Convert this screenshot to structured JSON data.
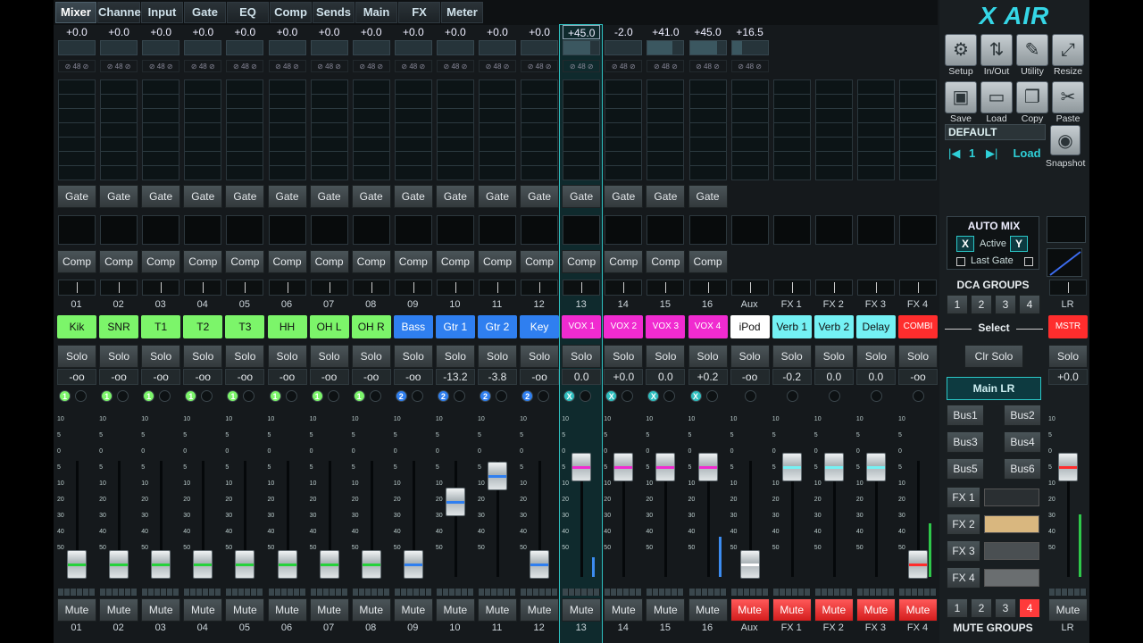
{
  "tabs": [
    "Mixer",
    "Channel",
    "Input",
    "Gate",
    "EQ",
    "Comp",
    "Sends",
    "Main",
    "FX",
    "Meter"
  ],
  "active_tab": "Mixer",
  "colors": {
    "green": "#7cf56a",
    "blue": "#2f7ff0",
    "magenta": "#f02bd0",
    "white": "#ffffff",
    "cyan": "#74f1f4",
    "red": "#ff2d2d",
    "teal": "#2fbfbf"
  },
  "channels": [
    {
      "num": "01",
      "name": "Kik",
      "color": "green",
      "gain": "+0.0",
      "fader_value": "-oo",
      "bus": "1",
      "bus_color": "green",
      "level": 0.0,
      "gate": "Gate",
      "comp": "Comp",
      "solo": "Solo",
      "mute": "Mute",
      "mute_on": false,
      "fline": "#26d23b",
      "meter": 0
    },
    {
      "num": "02",
      "name": "SNR",
      "color": "green",
      "gain": "+0.0",
      "fader_value": "-oo",
      "bus": "1",
      "bus_color": "green",
      "level": 0.0,
      "gate": "Gate",
      "comp": "Comp",
      "solo": "Solo",
      "mute": "Mute",
      "mute_on": false,
      "fline": "#26d23b",
      "meter": 0
    },
    {
      "num": "03",
      "name": "T1",
      "color": "green",
      "gain": "+0.0",
      "fader_value": "-oo",
      "bus": "1",
      "bus_color": "green",
      "level": 0.0,
      "gate": "Gate",
      "comp": "Comp",
      "solo": "Solo",
      "mute": "Mute",
      "mute_on": false,
      "fline": "#26d23b",
      "meter": 0
    },
    {
      "num": "04",
      "name": "T2",
      "color": "green",
      "gain": "+0.0",
      "fader_value": "-oo",
      "bus": "1",
      "bus_color": "green",
      "level": 0.0,
      "gate": "Gate",
      "comp": "Comp",
      "solo": "Solo",
      "mute": "Mute",
      "mute_on": false,
      "fline": "#26d23b",
      "meter": 0
    },
    {
      "num": "05",
      "name": "T3",
      "color": "green",
      "gain": "+0.0",
      "fader_value": "-oo",
      "bus": "1",
      "bus_color": "green",
      "level": 0.0,
      "gate": "Gate",
      "comp": "Comp",
      "solo": "Solo",
      "mute": "Mute",
      "mute_on": false,
      "fline": "#26d23b",
      "meter": 0
    },
    {
      "num": "06",
      "name": "HH",
      "color": "green",
      "gain": "+0.0",
      "fader_value": "-oo",
      "bus": "1",
      "bus_color": "green",
      "level": 0.0,
      "gate": "Gate",
      "comp": "Comp",
      "solo": "Solo",
      "mute": "Mute",
      "mute_on": false,
      "fline": "#26d23b",
      "meter": 0
    },
    {
      "num": "07",
      "name": "OH L",
      "color": "green",
      "gain": "+0.0",
      "fader_value": "-oo",
      "bus": "1",
      "bus_color": "green",
      "level": 0.0,
      "gate": "Gate",
      "comp": "Comp",
      "solo": "Solo",
      "mute": "Mute",
      "mute_on": false,
      "fline": "#26d23b",
      "meter": 0
    },
    {
      "num": "08",
      "name": "OH R",
      "color": "green",
      "gain": "+0.0",
      "fader_value": "-oo",
      "bus": "1",
      "bus_color": "green",
      "level": 0.0,
      "gate": "Gate",
      "comp": "Comp",
      "solo": "Solo",
      "mute": "Mute",
      "mute_on": false,
      "fline": "#26d23b",
      "meter": 0
    },
    {
      "num": "09",
      "name": "Bass",
      "color": "blue",
      "gain": "+0.0",
      "fader_value": "-oo",
      "bus": "2",
      "bus_color": "blue",
      "level": 0.0,
      "gate": "Gate",
      "comp": "Comp",
      "solo": "Solo",
      "mute": "Mute",
      "mute_on": false,
      "fline": "#2f7ff0",
      "meter": 0
    },
    {
      "num": "10",
      "name": "Gtr 1",
      "color": "blue",
      "gain": "+0.0",
      "fader_value": "-13.2",
      "bus": "2",
      "bus_color": "blue",
      "level": 0.48,
      "gate": "Gate",
      "comp": "Comp",
      "solo": "Solo",
      "mute": "Mute",
      "mute_on": false,
      "fline": "#2f7ff0",
      "meter": 0
    },
    {
      "num": "11",
      "name": "Gtr 2",
      "color": "blue",
      "gain": "+0.0",
      "fader_value": "-3.8",
      "bus": "2",
      "bus_color": "blue",
      "level": 0.68,
      "gate": "Gate",
      "comp": "Comp",
      "solo": "Solo",
      "mute": "Mute",
      "mute_on": false,
      "fline": "#2f7ff0",
      "meter": 0
    },
    {
      "num": "12",
      "name": "Key",
      "color": "blue",
      "gain": "+0.0",
      "fader_value": "-oo",
      "bus": "2",
      "bus_color": "blue",
      "level": 0.0,
      "gate": "Gate",
      "comp": "Comp",
      "solo": "Solo",
      "mute": "Mute",
      "mute_on": false,
      "fline": "#2f7ff0",
      "meter": 0
    },
    {
      "num": "13",
      "name": "VOX 1",
      "color": "magenta",
      "gain": "+45.0",
      "fader_value": "0.0",
      "bus": "X",
      "bus_color": "teal",
      "level": 0.75,
      "gate": "Gate",
      "comp": "Comp",
      "solo": "Solo",
      "mute": "Mute",
      "mute_on": false,
      "fline": "#f02bd0",
      "meter": 0.15,
      "selected": true
    },
    {
      "num": "14",
      "name": "VOX 2",
      "color": "magenta",
      "gain": "-2.0",
      "fader_value": "+0.0",
      "bus": "X",
      "bus_color": "teal",
      "level": 0.75,
      "gate": "Gate",
      "comp": "Comp",
      "solo": "Solo",
      "mute": "Mute",
      "mute_on": false,
      "fline": "#f02bd0",
      "meter": 0
    },
    {
      "num": "15",
      "name": "VOX 3",
      "color": "magenta",
      "gain": "+41.0",
      "fader_value": "0.0",
      "bus": "X",
      "bus_color": "teal",
      "level": 0.75,
      "gate": "Gate",
      "comp": "Comp",
      "solo": "Solo",
      "mute": "Mute",
      "mute_on": false,
      "fline": "#f02bd0",
      "meter": 0
    },
    {
      "num": "16",
      "name": "VOX 4",
      "color": "magenta",
      "gain": "+45.0",
      "fader_value": "+0.2",
      "bus": "X",
      "bus_color": "teal",
      "level": 0.75,
      "gate": "Gate",
      "comp": "Comp",
      "solo": "Solo",
      "mute": "Mute",
      "mute_on": false,
      "fline": "#f02bd0",
      "meter": 0.3
    },
    {
      "num": "Aux",
      "name": "iPod",
      "color": "white",
      "gain": "+16.5",
      "fader_value": "-oo",
      "bus": "",
      "bus_color": "none",
      "level": 0.0,
      "gate": "",
      "comp": "",
      "solo": "Solo",
      "mute": "Mute",
      "mute_on": true,
      "fline": "#ffffff",
      "meter": 0
    },
    {
      "num": "FX 1",
      "name": "Verb 1",
      "color": "cyan",
      "gain": "",
      "fader_value": "-0.2",
      "bus": "",
      "bus_color": "none",
      "level": 0.75,
      "gate": "",
      "comp": "",
      "solo": "Solo",
      "mute": "Mute",
      "mute_on": true,
      "fline": "#74f1f4",
      "meter": 0
    },
    {
      "num": "FX 2",
      "name": "Verb 2",
      "color": "cyan",
      "gain": "",
      "fader_value": "0.0",
      "bus": "",
      "bus_color": "none",
      "level": 0.75,
      "gate": "",
      "comp": "",
      "solo": "Solo",
      "mute": "Mute",
      "mute_on": true,
      "fline": "#74f1f4",
      "meter": 0
    },
    {
      "num": "FX 3",
      "name": "Delay",
      "color": "cyan",
      "gain": "",
      "fader_value": "0.0",
      "bus": "",
      "bus_color": "none",
      "level": 0.75,
      "gate": "",
      "comp": "",
      "solo": "Solo",
      "mute": "Mute",
      "mute_on": true,
      "fline": "#74f1f4",
      "meter": 0
    },
    {
      "num": "FX 4",
      "name": "COMBI",
      "color": "red",
      "gain": "",
      "fader_value": "-oo",
      "bus": "",
      "bus_color": "none",
      "level": 0.0,
      "gate": "",
      "comp": "",
      "solo": "Solo",
      "mute": "Mute",
      "mute_on": true,
      "fline": "#ff2d2d",
      "meter": 0.4
    }
  ],
  "scale_labels": [
    "10",
    "5",
    "0",
    "5",
    "10",
    "20",
    "30",
    "40",
    "50"
  ],
  "sidebar": {
    "logo": "X AIR",
    "icons": [
      {
        "label": "Setup",
        "icon": "gear-icon"
      },
      {
        "label": "In/Out",
        "icon": "arrows-icon"
      },
      {
        "label": "Utility",
        "icon": "wrench-icon"
      },
      {
        "label": "Resize",
        "icon": "resize-icon"
      },
      {
        "label": "Save",
        "icon": "save-icon"
      },
      {
        "label": "Load",
        "icon": "folder-icon"
      },
      {
        "label": "Copy",
        "icon": "copy-icon"
      },
      {
        "label": "Paste",
        "icon": "paste-icon"
      }
    ],
    "preset": "DEFAULT",
    "scene_num": "1",
    "load": "Load",
    "snapshot": "Snapshot",
    "automix": {
      "title": "AUTO MIX",
      "x": "X",
      "active": "Active",
      "y": "Y",
      "last_gate": "Last Gate"
    },
    "dca_title": "DCA GROUPS",
    "dca": [
      "1",
      "2",
      "3",
      "4"
    ],
    "select": "Select",
    "clr_solo": "Clr Solo",
    "main_lr": "Main LR",
    "buses": [
      "Bus1",
      "Bus2",
      "Bus3",
      "Bus4",
      "Bus5",
      "Bus6"
    ],
    "fx": [
      "FX 1",
      "FX 2",
      "FX 3",
      "FX 4"
    ],
    "mute_groups": [
      "1",
      "2",
      "3",
      "4"
    ],
    "mute_groups_title": "MUTE GROUPS"
  },
  "master": {
    "num": "LR",
    "name": "MSTR",
    "solo": "Solo",
    "value": "+0.0",
    "mute": "Mute",
    "bottom": "LR",
    "level": 0.75
  }
}
